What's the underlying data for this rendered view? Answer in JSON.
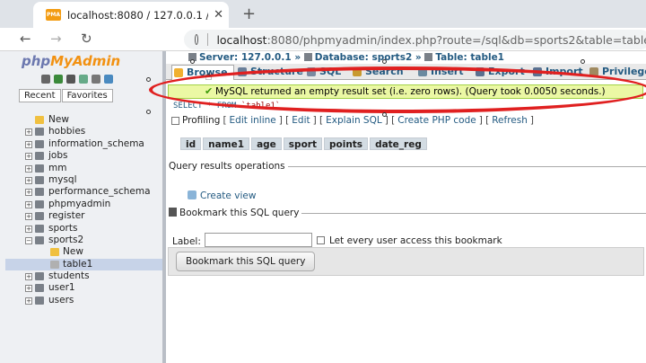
{
  "browser": {
    "tab_title": "localhost:8080 / 127.0.0.1 / spo",
    "favicon_label": "PMA",
    "url_host": "localhost",
    "url_rest": ":8080/phpmyadmin/index.php?route=/sql&db=sports2&table=table"
  },
  "sidebar": {
    "logo_php": "php",
    "logo_myadmin": "MyAdmin",
    "recent_label": "Recent",
    "favorites_label": "Favorites",
    "databases": [
      {
        "name": "New",
        "type": "new"
      },
      {
        "name": "hobbies",
        "type": "db"
      },
      {
        "name": "information_schema",
        "type": "db"
      },
      {
        "name": "jobs",
        "type": "db"
      },
      {
        "name": "mm",
        "type": "db"
      },
      {
        "name": "mysql",
        "type": "db"
      },
      {
        "name": "performance_schema",
        "type": "db"
      },
      {
        "name": "phpmyadmin",
        "type": "db"
      },
      {
        "name": "register",
        "type": "db"
      },
      {
        "name": "sports",
        "type": "db"
      },
      {
        "name": "sports2",
        "type": "db",
        "expanded": true
      },
      {
        "name": "New",
        "type": "sub-new"
      },
      {
        "name": "table1",
        "type": "sub-table",
        "selected": true
      },
      {
        "name": "students",
        "type": "db"
      },
      {
        "name": "user1",
        "type": "db"
      },
      {
        "name": "users",
        "type": "db"
      }
    ]
  },
  "breadcrumb": {
    "server": "Server: 127.0.0.1",
    "database": "Database: sports2",
    "table": "Table: table1",
    "sep": "»"
  },
  "tabs": [
    {
      "label": "Browse",
      "active": true,
      "color": "#f0b030"
    },
    {
      "label": "Structure",
      "color": "#6a7f99"
    },
    {
      "label": "SQL",
      "color": "#7a8aa0"
    },
    {
      "label": "Search",
      "color": "#c89a30"
    },
    {
      "label": "Insert",
      "color": "#6a8aa0"
    },
    {
      "label": "Export",
      "color": "#5a7090"
    },
    {
      "label": "Import",
      "color": "#5a7090"
    },
    {
      "label": "Privilege",
      "color": "#a08a60"
    }
  ],
  "message": {
    "text": "MySQL returned an empty result set (i.e. zero rows). (Query took 0.0050 seconds.)"
  },
  "sql": {
    "select_kw": "SELECT",
    "star": " * ",
    "from_kw": "FROM",
    "table": " `table1`"
  },
  "sql_links": {
    "profiling": "Profiling",
    "edit_inline": "Edit inline",
    "edit": "Edit",
    "explain": "Explain SQL",
    "create_php": "Create PHP code",
    "refresh": "Refresh"
  },
  "columns": [
    "id",
    "name1",
    "age",
    "sport",
    "points",
    "date_reg"
  ],
  "query_ops": {
    "legend": "Query results operations",
    "create_view": "Create view"
  },
  "bookmark": {
    "legend": "Bookmark this SQL query",
    "label": "Label:",
    "label_value": "",
    "let_every_user": "Let every user access this bookmark",
    "button": "Bookmark this SQL query"
  }
}
